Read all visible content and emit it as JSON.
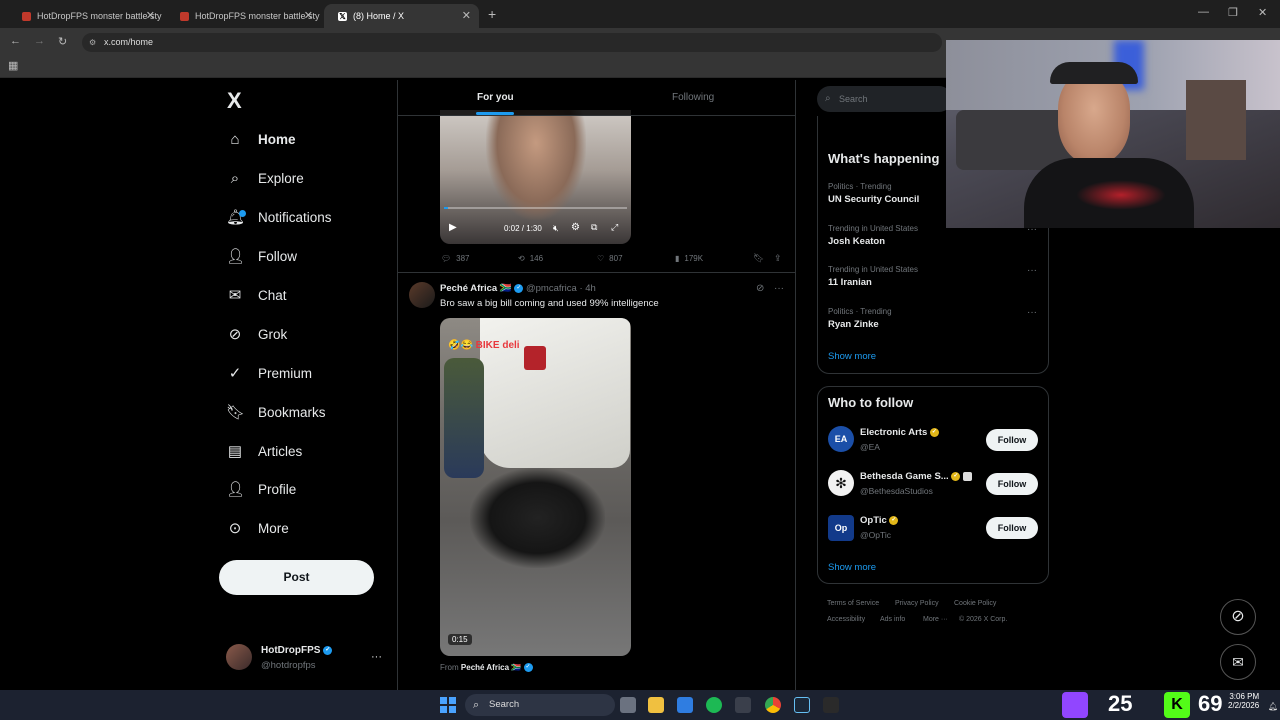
{
  "browser": {
    "tabs": [
      {
        "title": "HotDropFPS monster battle sty"
      },
      {
        "title": "HotDropFPS monster battle sty"
      },
      {
        "title": "(8) Home / X"
      }
    ],
    "url": "x.com/home"
  },
  "sidebar": {
    "logo": "X",
    "items": [
      {
        "label": "Home",
        "icon": "home-icon"
      },
      {
        "label": "Explore",
        "icon": "search-icon"
      },
      {
        "label": "Notifications",
        "icon": "bell-icon"
      },
      {
        "label": "Follow",
        "icon": "person-add-icon"
      },
      {
        "label": "Chat",
        "icon": "mail-icon"
      },
      {
        "label": "Grok",
        "icon": "grok-icon"
      },
      {
        "label": "Premium",
        "icon": "verified-icon"
      },
      {
        "label": "Bookmarks",
        "icon": "bookmark-icon"
      },
      {
        "label": "Articles",
        "icon": "article-icon"
      },
      {
        "label": "Profile",
        "icon": "person-icon"
      },
      {
        "label": "More",
        "icon": "more-circle-icon"
      }
    ],
    "post_label": "Post",
    "account": {
      "name": "HotDropFPS",
      "handle": "@hotdropfps"
    }
  },
  "feed": {
    "tabs": [
      "For you",
      "Following"
    ],
    "post1": {
      "video_time": "0:02 / 1:30",
      "progress": 0.02,
      "replies": "387",
      "reposts": "146",
      "likes": "807",
      "views": "179K"
    },
    "post2": {
      "author": "Peché Africa",
      "flag": "🇿🇦",
      "handle": "@pmcafrica",
      "time": "4h",
      "text": "Bro saw a big bill coming and used 99% intelligence",
      "overlay_text": "🤣😂 BIKE deli",
      "duration": "0:15",
      "from_label": "From",
      "from_name": "Peché Africa"
    }
  },
  "right": {
    "search_placeholder": "Search",
    "happening_title": "What's happening",
    "trends": [
      {
        "meta": "Politics · Trending",
        "name": "UN Security Council"
      },
      {
        "meta": "Trending in United States",
        "name": "Josh Keaton"
      },
      {
        "meta": "Trending in United States",
        "name": "11 Iranian"
      },
      {
        "meta": "Politics · Trending",
        "name": "Ryan Zinke"
      }
    ],
    "show_more": "Show more",
    "wtf_title": "Who to follow",
    "wtf": [
      {
        "name": "Electronic Arts",
        "handle": "@EA",
        "badge": "gold",
        "avatar_text": "EA"
      },
      {
        "name": "Bethesda Game S...",
        "handle": "@BethesdaStudios",
        "badge": "gold",
        "avatar_text": "✻"
      },
      {
        "name": "OpTic",
        "handle": "@OpTic",
        "badge": "gold",
        "avatar_text": "Op"
      }
    ],
    "follow_label": "Follow",
    "footer": [
      "Terms of Service",
      "Privacy Policy",
      "Cookie Policy",
      "Accessibility",
      "Ads info",
      "More ···",
      "© 2026 X Corp."
    ]
  },
  "taskbar": {
    "search_label": "Search",
    "counter1": "25",
    "counter2": "69",
    "time": "3:06 PM",
    "date": "2/2/2026"
  },
  "colors": {
    "accent": "#1d9bf0",
    "background": "#000000",
    "gold": "#e2b719"
  }
}
